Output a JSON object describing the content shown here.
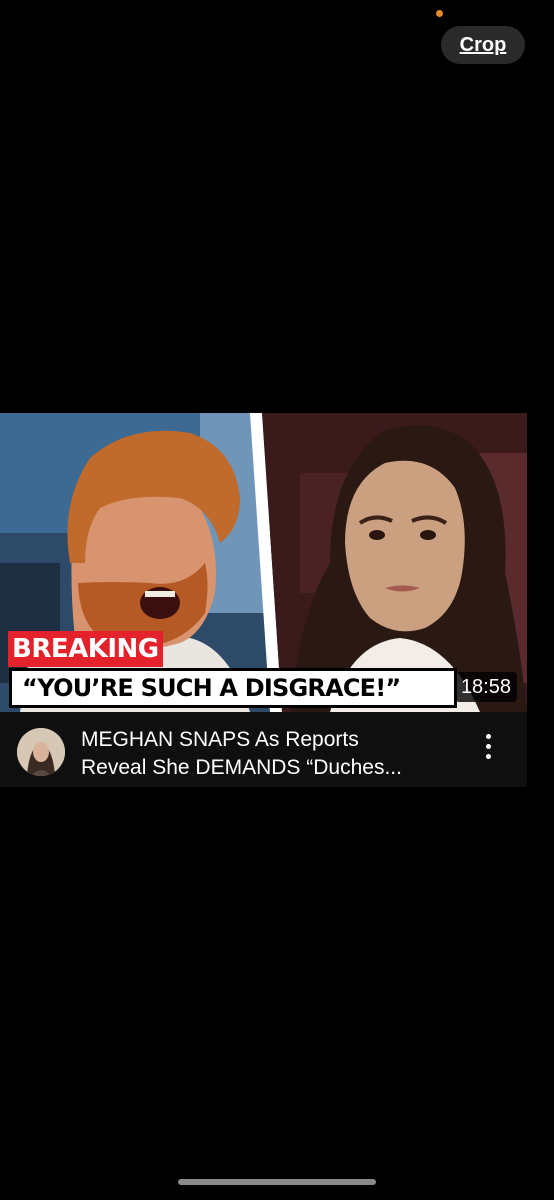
{
  "toolbar": {
    "crop_label": "Crop"
  },
  "video": {
    "breaking_label": "BREAKING",
    "quote_text": "“YOU’RE SUCH A DISGRACE!”",
    "duration": "18:58",
    "title": "MEGHAN SNAPS As Reports\nReveal She DEMANDS “Duches..."
  },
  "colors": {
    "accent_red": "#e4222b",
    "status_dot": "#e8892b",
    "background": "#000000",
    "meta_background": "#0f0f0f"
  },
  "icons": {
    "more": "vertical-ellipsis-icon",
    "avatar": "channel-avatar"
  }
}
